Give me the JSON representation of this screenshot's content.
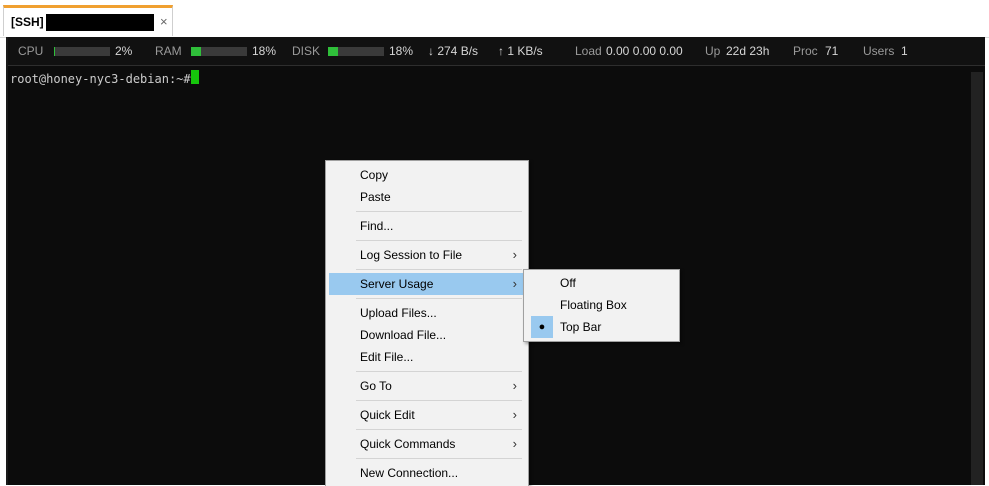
{
  "tab": {
    "title": "[SSH]",
    "close": "×"
  },
  "status": {
    "cpu": {
      "label": "CPU",
      "value": "2%",
      "fill": 0.02
    },
    "ram": {
      "label": "RAM",
      "value": "18%",
      "fill": 0.18
    },
    "disk": {
      "label": "DISK",
      "value": "18%",
      "fill": 0.18
    },
    "down": "↓ 274 B/s",
    "up": "↑ 1 KB/s",
    "load": {
      "label": "Load",
      "value": "0.00 0.00 0.00"
    },
    "uptime": {
      "label": "Up",
      "value": "22d 23h"
    },
    "proc": {
      "label": "Proc",
      "value": "71"
    },
    "users": {
      "label": "Users",
      "value": "1"
    }
  },
  "terminal": {
    "prompt": "root@honey-nyc3-debian:~#"
  },
  "context_menu": {
    "copy": "Copy",
    "paste": "Paste",
    "find": "Find...",
    "log_session": "Log Session to File",
    "server_usage": "Server Usage",
    "upload": "Upload Files...",
    "download": "Download File...",
    "edit": "Edit File...",
    "go_to": "Go To",
    "quick_edit": "Quick Edit",
    "quick_commands": "Quick Commands",
    "new_connection": "New Connection...",
    "arrow": "›"
  },
  "submenu": {
    "off": "Off",
    "floating_box": "Floating Box",
    "top_bar": "Top Bar",
    "selected_marker": "●"
  },
  "colors": {
    "accent": "#f0a030",
    "meter": "#2fbf3a",
    "cursor": "#16c60c",
    "highlight": "#99c9ef"
  }
}
